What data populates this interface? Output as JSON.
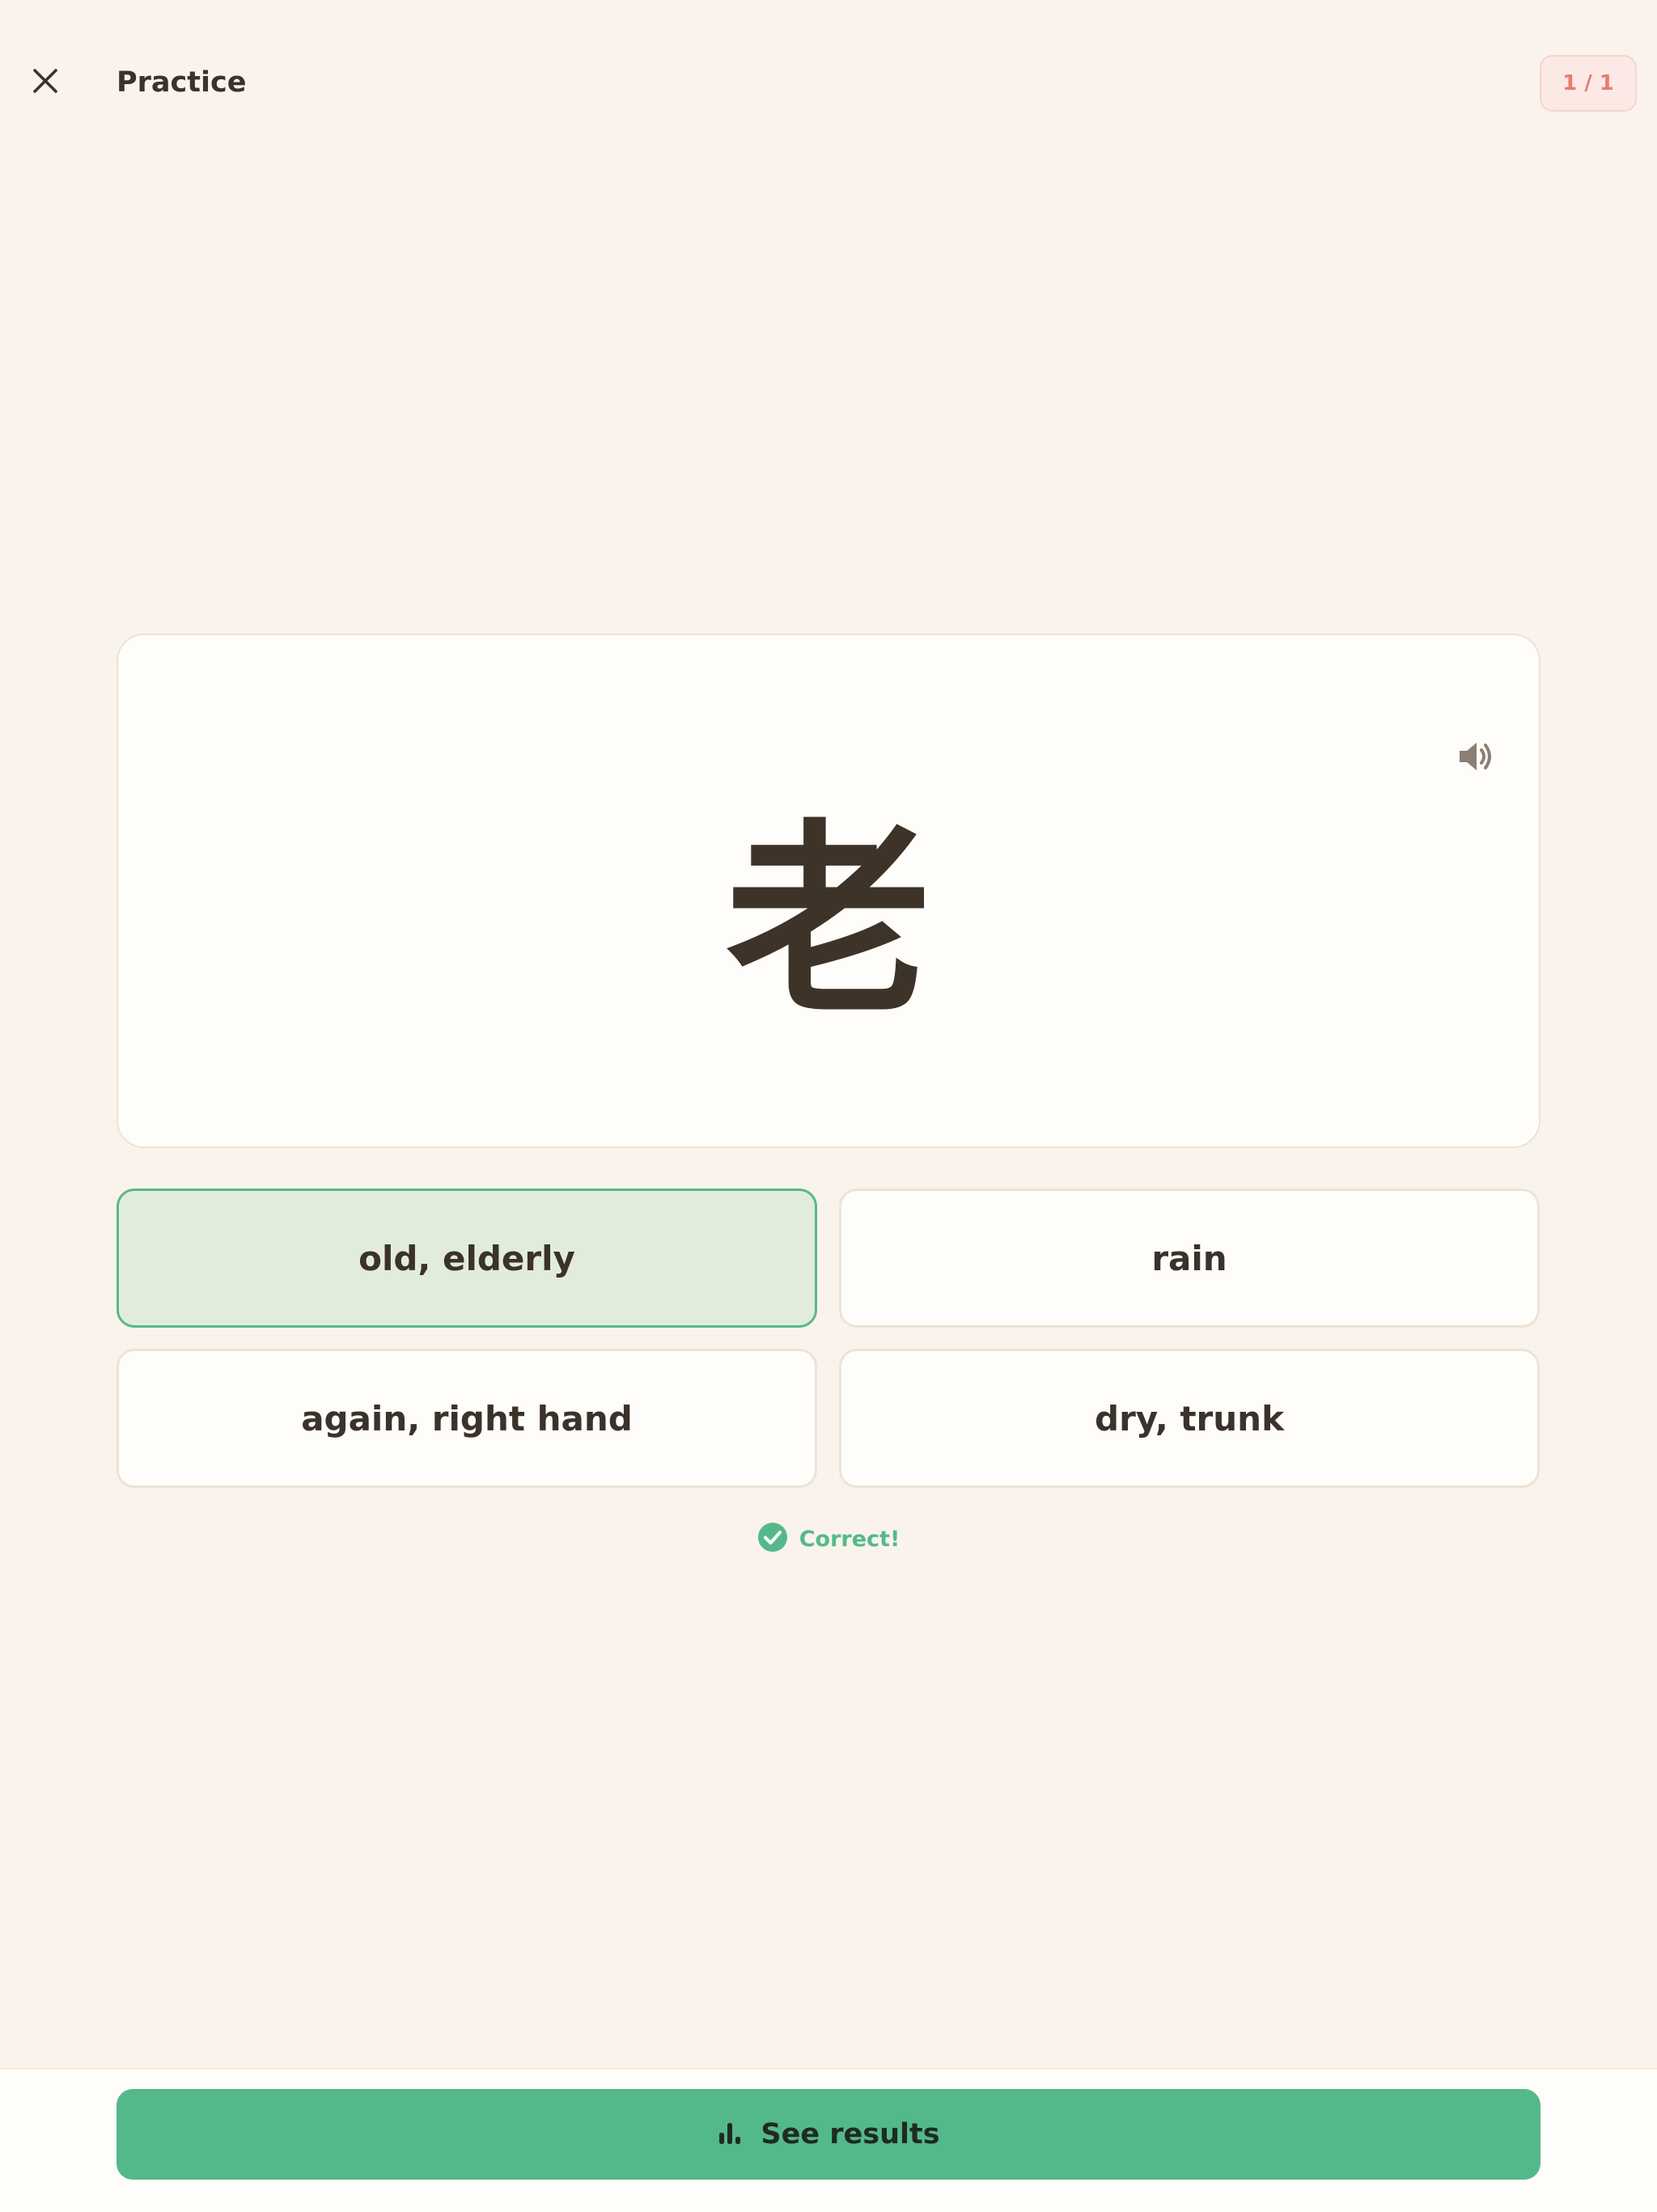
{
  "header": {
    "title": "Practice",
    "close_icon": "close-icon",
    "counter": "1 / 1"
  },
  "card": {
    "character": "老",
    "audio_icon": "speaker-icon"
  },
  "options": [
    {
      "label": "old, elderly",
      "state": "correct"
    },
    {
      "label": "rain",
      "state": "default"
    },
    {
      "label": "again, right hand",
      "state": "default"
    },
    {
      "label": "dry, trunk",
      "state": "default"
    }
  ],
  "feedback": {
    "text": "Correct!",
    "icon": "check-circle-icon"
  },
  "footer": {
    "button_label": "See results",
    "button_icon": "bar-chart-icon"
  },
  "colors": {
    "background": "#f9f3ec",
    "accent_green": "#54b98a",
    "correct_fill": "#e2ecdd",
    "badge_text": "#e77d70",
    "badge_fill": "#fce9e5"
  }
}
